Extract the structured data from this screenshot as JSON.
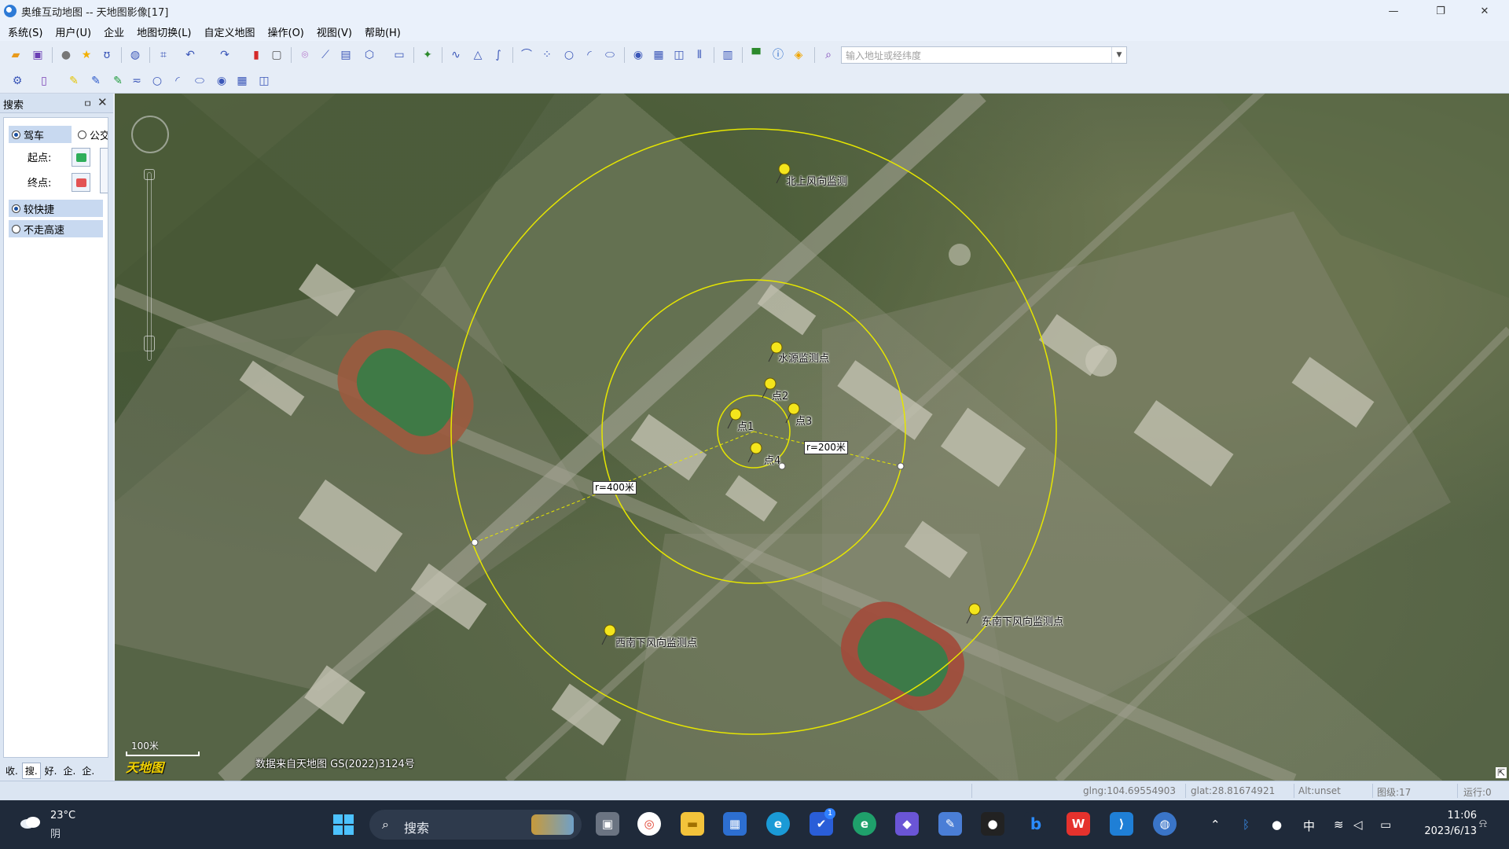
{
  "window": {
    "title": "奥维互动地图 -- 天地图影像[17]",
    "controls": {
      "minimize": "—",
      "restore": "❐",
      "close": "✕"
    }
  },
  "menu": [
    "系统(S)",
    "用户(U)",
    "企业",
    "地图切换(L)",
    "自定义地图",
    "操作(O)",
    "视图(V)",
    "帮助(H)"
  ],
  "toolbar": {
    "address_placeholder": "输入地址或经纬度"
  },
  "search_panel": {
    "title": "搜索",
    "pin": "ㅁ",
    "close": "✕",
    "mode_drive": "驾车",
    "mode_bus": "公交",
    "start_label": "起点:",
    "end_label": "终点:",
    "route_fast": "较快捷",
    "route_no_highway": "不走高速",
    "tabs": [
      "收.",
      "搜.",
      "好.",
      "企.",
      "企."
    ]
  },
  "map": {
    "markers": [
      {
        "id": "north",
        "label": "北上风向监测"
      },
      {
        "id": "water",
        "label": "水源监测点"
      },
      {
        "id": "p2",
        "label": "点2"
      },
      {
        "id": "p1",
        "label": "点1"
      },
      {
        "id": "p3",
        "label": "点3"
      },
      {
        "id": "p4",
        "label": "点4"
      },
      {
        "id": "southwest",
        "label": "西南下风向监测点"
      },
      {
        "id": "southeast",
        "label": "东南下风向监测点"
      }
    ],
    "radius_labels": {
      "r200": "r=200米",
      "r400": "r=400米"
    },
    "scale": "100米",
    "logo": "天地图",
    "copyright": "数据来自天地图  GS(2022)3124号",
    "accent_color": "#e6e600"
  },
  "status": {
    "lng": "glng:104.69554903",
    "lat": "glat:28.81674921",
    "alt": "Alt:unset",
    "level": "图级:17",
    "run": "运行:0"
  },
  "taskbar": {
    "weather_temp": "23°C",
    "weather_desc": "阴",
    "search": "搜索",
    "ime": "中",
    "time": "11:06",
    "date": "2023/6/13",
    "badge": "1"
  }
}
